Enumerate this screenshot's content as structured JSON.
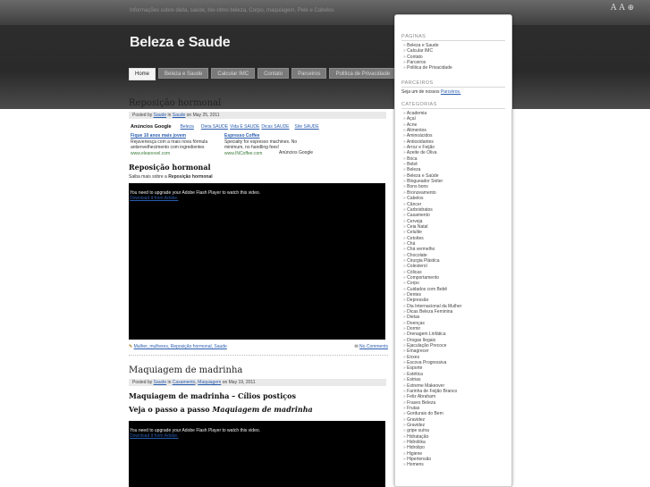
{
  "header": {
    "tagline": "Informações sobre dieta, saúde, bio-ritmo beleza, Corpo, maquiagem, Pele e Cabelos",
    "font_tool": "A A ⊕",
    "site_title": "Beleza e Saude"
  },
  "nav": {
    "tabs": [
      {
        "label": "Home",
        "active": true
      },
      {
        "label": "Beleza e Saude",
        "active": false
      },
      {
        "label": "Calcular IMC",
        "active": false
      },
      {
        "label": "Contato",
        "active": false
      },
      {
        "label": "Parceiros",
        "active": false
      },
      {
        "label": "Politica de Privacidade",
        "active": false
      }
    ]
  },
  "post1": {
    "title": "Reposição hormonal",
    "meta_prefix": "Posted by",
    "author": "Saude",
    "meta_in": "in",
    "category": "Saude",
    "meta_date": "on May 25, 2011",
    "ads_label": "Anúncios Google",
    "ads_links": [
      "Beleza",
      "Dieta SAUDE",
      "Vida E SAUDE",
      "Dicas SAUDE",
      "Site SAUDE"
    ],
    "ad1": {
      "headline": "Fique 10 anos mais jovem",
      "line1": "Rejuvenesça com a mais nova fórmula",
      "line2": "antienvelhecimento com ingredientes",
      "url": "www.eleanovel.com"
    },
    "ad2": {
      "headline": "Espresso Coffee",
      "line1": "Specialty for espresso machines. No",
      "line2": "minimum, no handling fees!",
      "url": "www.INCoffee.com"
    },
    "ads_by": "Anúncios Google",
    "sub_heading": "Reposição hormonal",
    "saiba_prefix": "Saiba mais sobre a",
    "saiba_topic": "Reposição hormonal",
    "flash_msg": "You need to upgrade your Adobe Flash Player to watch this video.",
    "flash_link": "Download it from Adobe.",
    "tags": "Mulher, mulheres, Reposição hormonal, Saude",
    "comments": "No Comments"
  },
  "post2": {
    "title": "Maquiagem de madrinha",
    "meta_prefix": "Posted by",
    "author": "Saude",
    "meta_in": "in",
    "category1": "Casamento",
    "category2": "Maquiagem",
    "meta_date": "on May 19, 2011",
    "heading1": "Maquiagem de madrinha – Cílios postiços",
    "heading2_prefix": "Veja o passo a passo",
    "heading2_em": "Maquiagem de madrinha",
    "flash_msg": "You need to upgrade your Adobe Flash Player to watch this video.",
    "flash_link": "Download it from Adobe."
  },
  "sidebar": {
    "paginas_heading": "PÁGINAS",
    "paginas": [
      "Beleza e Saude",
      "Calcular IMC",
      "Contato",
      "Parceiros",
      "Politica de Privacidade"
    ],
    "parceiros_heading": "PARCEIROS",
    "parceiros_text": "Seja um de nossos",
    "parceiros_link": "Parceiros.",
    "categorias_heading": "CATEGORIAS",
    "categorias": [
      "Academia",
      "Açaí",
      "Acne",
      "Alimentos",
      "Aminoácidos",
      "Antioxidantes",
      "Arroz e Feijão",
      "Azeite de Oliva",
      "Boca",
      "Bebê",
      "Beleza",
      "Beleza e Saúde",
      "Blogueador Sniter",
      "Bons bons",
      "Bronzeamento",
      "Cabelos",
      "Câncer",
      "Carboidratos",
      "Casamento",
      "Cerveja",
      "Ceia Natal",
      "Celulite",
      "Cetoítes",
      "Chá",
      "Chá vermelho",
      "Chocolate",
      "Cirurgia Plástica",
      "Colesterol",
      "Cólicas",
      "Comportamento",
      "Corpo",
      "Cuidados com Bebê",
      "Dentes",
      "Depressão",
      "Dia Internacional da Mulher",
      "Dicas Beleza Feminina",
      "Dietas",
      "Doenças",
      "Dormir",
      "Drenagem Linfática",
      "Drogas Ilegais",
      "Ejaculação Precoce",
      "Emagrecer",
      "Enxes",
      "Escova Progressiva",
      "Esporte",
      "Estética",
      "Estrias",
      "Extreme Makeover",
      "Farinha de Feijão Branco",
      "Feliz Abraham",
      "Frases Beleza",
      "Frutas",
      "Gordurais do Bem",
      "Gravidez",
      "Gravidez",
      "gripe suína",
      "Hidratação",
      "Hidroliika",
      "Hidrolipo",
      "Higiene",
      "Hipertensão",
      "Homens"
    ]
  }
}
